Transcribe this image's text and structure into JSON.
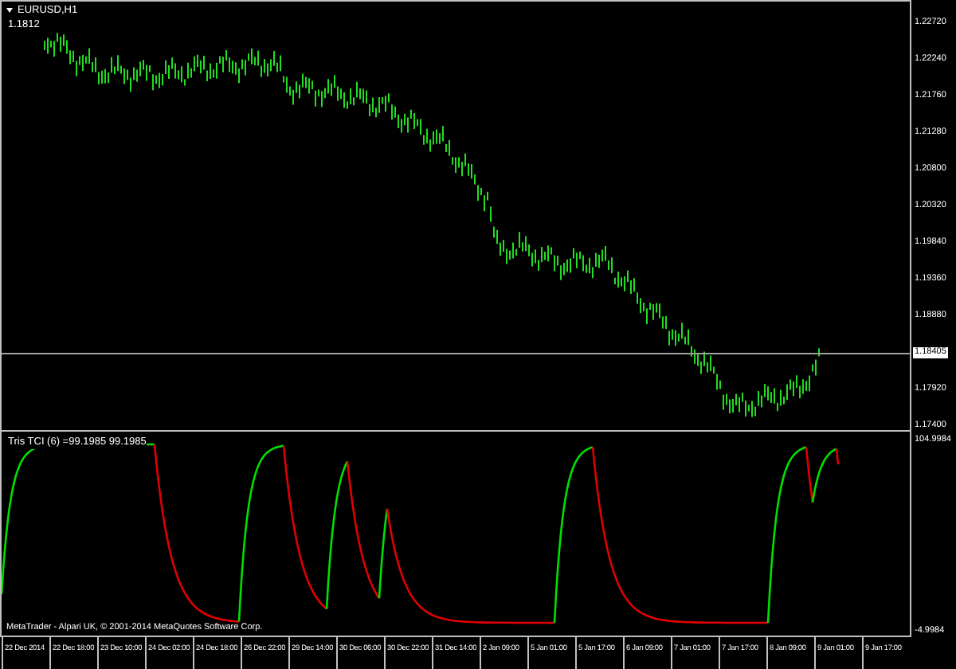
{
  "main_chart": {
    "title": "EURUSD,H1",
    "price_label": "1.1812"
  },
  "price_axis": {
    "labels": [
      {
        "text": "1.22720",
        "kind": "tick"
      },
      {
        "text": "1.22240",
        "kind": "tick"
      },
      {
        "text": "1.21760",
        "kind": "tick"
      },
      {
        "text": "1.21280",
        "kind": "tick"
      },
      {
        "text": "1.20800",
        "kind": "tick"
      },
      {
        "text": "1.20320",
        "kind": "tick"
      },
      {
        "text": "1.19840",
        "kind": "tick"
      },
      {
        "text": "1.19360",
        "kind": "tick"
      },
      {
        "text": "1.18880",
        "kind": "tick"
      },
      {
        "text": "1.18405",
        "kind": "current"
      },
      {
        "text": "1.17920",
        "kind": "tick"
      },
      {
        "text": "1.17400",
        "kind": "tick"
      }
    ]
  },
  "indicator": {
    "title": "Tris TCI (6) =99.1985 99.1985",
    "copyright": "MetaTrader - Alpari UK, © 2001-2014 MetaQuotes Software Corp.",
    "axis_labels": [
      "104.9984",
      "-4.9984"
    ]
  },
  "time_axis": {
    "labels": [
      "22 Dec 2014",
      "22 Dec 18:00",
      "23 Dec 10:00",
      "24 Dec 02:00",
      "24 Dec 18:00",
      "26 Dec 22:00",
      "29 Dec 14:00",
      "30 Dec 06:00",
      "30 Dec 22:00",
      "31 Dec 14:00",
      "2 Jan 09:00",
      "5 Jan 01:00",
      "5 Jan 17:00",
      "6 Jan 09:00",
      "7 Jan 01:00",
      "7 Jan 17:00",
      "8 Jan 09:00",
      "9 Jan 01:00",
      "9 Jan 17:00"
    ]
  }
}
